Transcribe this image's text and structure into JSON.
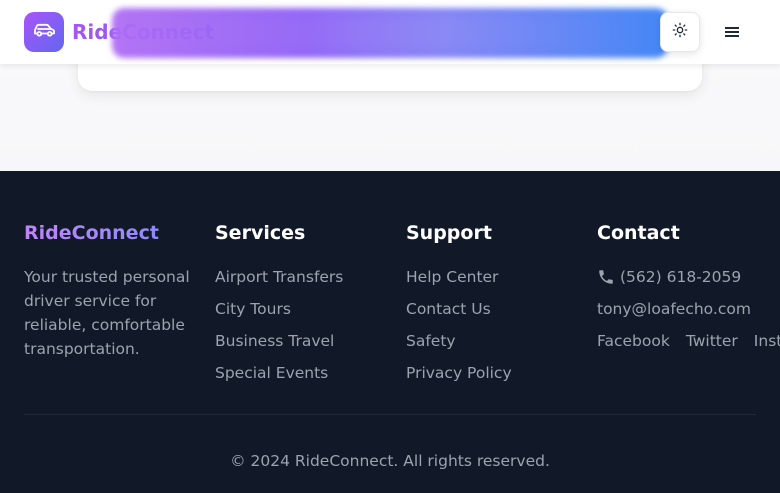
{
  "brand": {
    "name": "RideConnect",
    "gradient_from": "#a855f7",
    "gradient_to": "#6366f1"
  },
  "navbar": {
    "theme_toggle_icon": "sun-icon",
    "menu_icon": "hamburger-menu-icon"
  },
  "footer": {
    "brand": {
      "title": "RideConnect",
      "description": "Your trusted personal driver service for reliable, comfortable transportation."
    },
    "services": {
      "title": "Services",
      "items": [
        "Airport Transfers",
        "City Tours",
        "Business Travel",
        "Special Events"
      ]
    },
    "support": {
      "title": "Support",
      "items": [
        "Help Center",
        "Contact Us",
        "Safety",
        "Privacy Policy"
      ]
    },
    "contact": {
      "title": "Contact",
      "phone": "(562) 618-2059",
      "email": "tony@loafecho.com",
      "socials": [
        "Facebook",
        "Twitter",
        "Instagram"
      ]
    },
    "copyright": "© 2024 RideConnect. All rights reserved."
  },
  "colors": {
    "footer_bg": "#111827",
    "footer_text": "#9ca3af",
    "heading": "#ffffff"
  }
}
